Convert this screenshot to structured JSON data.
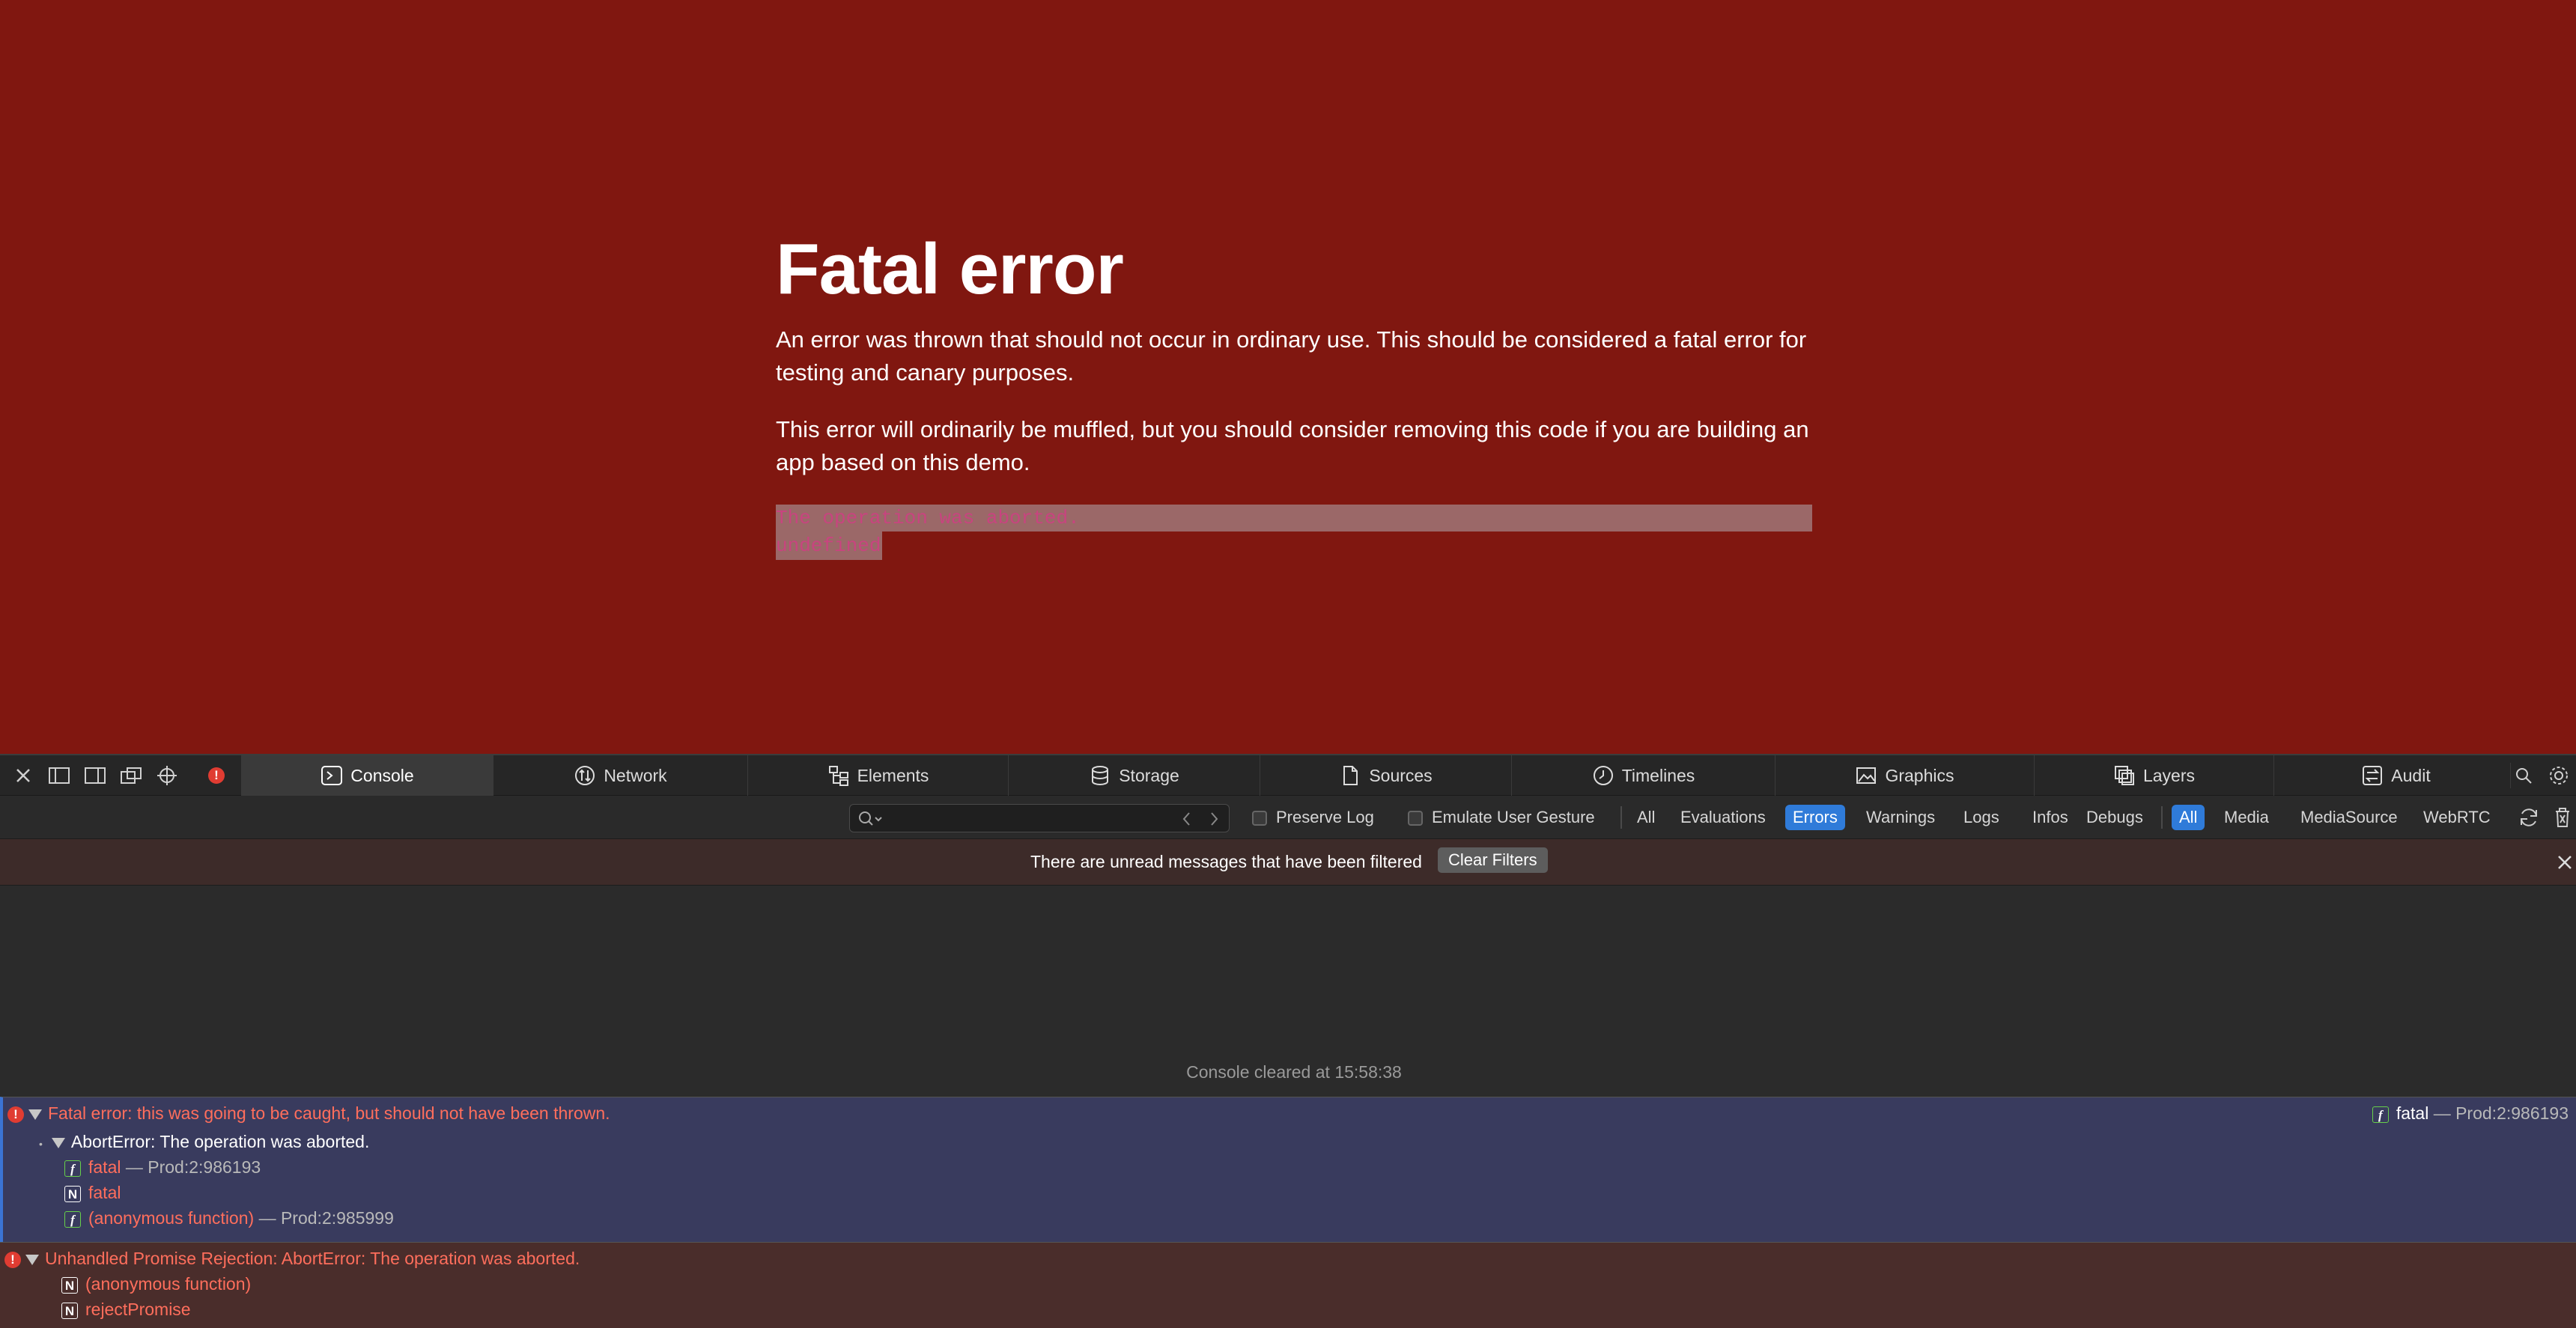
{
  "page": {
    "title": "Fatal error",
    "paragraph1": "An error was thrown that should not occur in ordinary use. This should be considered a fatal error for testing and canary purposes.",
    "paragraph2": "This error will ordinarily be muffled, but you should consider removing this code if you are building an app based on this demo.",
    "error_line1": "The operation was aborted.",
    "error_line2": "undefined"
  },
  "devtools": {
    "tabs": [
      {
        "label": "Console",
        "icon": "console-icon"
      },
      {
        "label": "Network",
        "icon": "network-icon"
      },
      {
        "label": "Elements",
        "icon": "elements-icon"
      },
      {
        "label": "Storage",
        "icon": "storage-icon"
      },
      {
        "label": "Sources",
        "icon": "sources-icon"
      },
      {
        "label": "Timelines",
        "icon": "timelines-icon"
      },
      {
        "label": "Graphics",
        "icon": "graphics-icon"
      },
      {
        "label": "Layers",
        "icon": "layers-icon"
      },
      {
        "label": "Audit",
        "icon": "audit-icon"
      }
    ],
    "active_tab": "Console",
    "filter": {
      "search_value": "",
      "preserve_log": "Preserve Log",
      "emulate_user_gesture": "Emulate User Gesture",
      "levels": [
        "All",
        "Evaluations",
        "Errors",
        "Warnings",
        "Logs",
        "Infos",
        "Debugs"
      ],
      "active_level": "Errors",
      "sources": [
        "All",
        "Media",
        "MediaSource",
        "WebRTC"
      ],
      "active_source": "All"
    },
    "banner": {
      "message": "There are unread messages that have been filtered",
      "button": "Clear Filters"
    },
    "console_cleared": "Console cleared at 15:58:38",
    "messages": [
      {
        "text": "Fatal error: this was going to be caught, but should not have been thrown.",
        "location_fn": "fatal",
        "location": "— Prod:2:986193",
        "sub": "AbortError: The operation was aborted.",
        "stack": [
          {
            "badge": "f",
            "fn": "fatal",
            "loc": "— Prod:2:986193"
          },
          {
            "badge": "N",
            "fn": "fatal",
            "loc": ""
          },
          {
            "badge": "f",
            "fn": "(anonymous function)",
            "loc": "— Prod:2:985999"
          }
        ]
      },
      {
        "text": "Unhandled Promise Rejection: AbortError: The operation was aborted.",
        "stack": [
          {
            "badge": "N",
            "fn": "(anonymous function)",
            "loc": ""
          },
          {
            "badge": "N",
            "fn": "rejectPromise",
            "loc": ""
          }
        ]
      }
    ],
    "colors": {
      "page_bg": "#801710",
      "error_text": "#ff6e5c",
      "accent": "#2f7bd9"
    }
  }
}
